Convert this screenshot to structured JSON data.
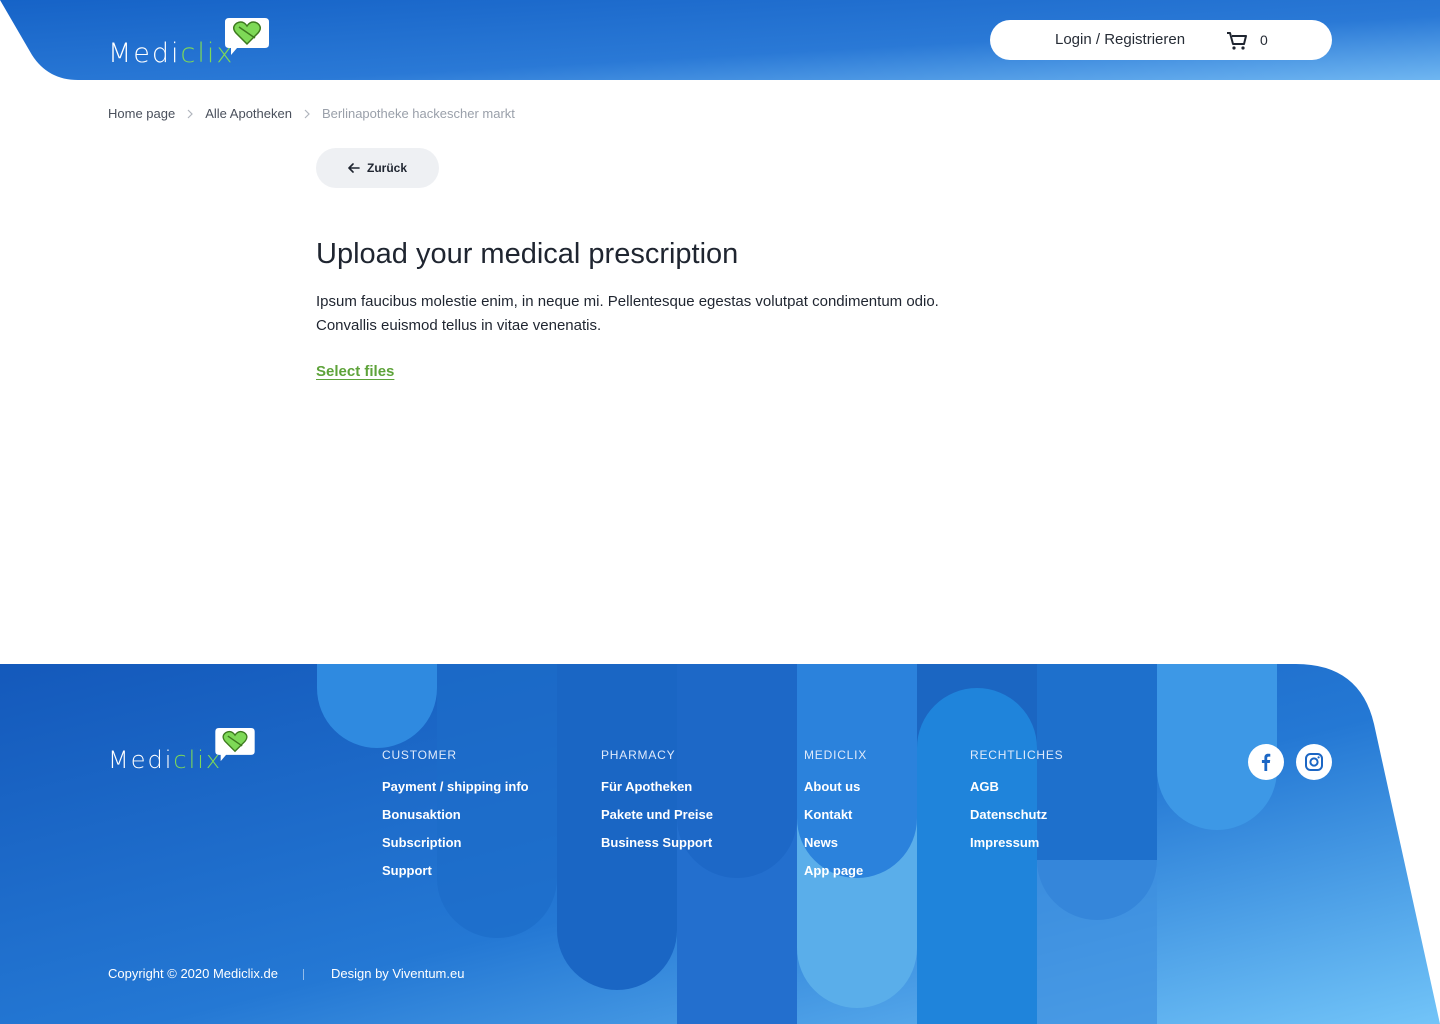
{
  "brand": {
    "name_part1": "Medi",
    "name_part2": "clix",
    "accent_green": "#7ed957",
    "primary_blue": "#1565c0"
  },
  "header": {
    "login_label": "Login / Registrieren",
    "cart_count": "0"
  },
  "breadcrumb": {
    "items": [
      "Home page",
      "Alle Apotheken",
      "Berlinapotheke hackescher markt"
    ]
  },
  "back_button": {
    "label": "Zurück"
  },
  "main": {
    "title": "Upload your medical prescription",
    "description_line1": "Ipsum faucibus molestie enim, in neque mi. Pellentesque egestas volutpat condimentum odio.",
    "description_line2": "Convallis euismod tellus in vitae venenatis.",
    "select_files_label": "Select files"
  },
  "footer": {
    "columns": [
      {
        "title": "CUSTOMER",
        "links": [
          "Payment / shipping info",
          "Bonusaktion",
          "Subscription",
          "Support"
        ]
      },
      {
        "title": "PHARMACY",
        "links": [
          "Für Apotheken",
          "Pakete und Preise",
          "Business Support"
        ]
      },
      {
        "title": "MEDICLIX",
        "links": [
          "About us",
          "Kontakt",
          "News",
          "App page"
        ]
      },
      {
        "title": "RECHTLICHES",
        "links": [
          "AGB",
          "Datenschutz",
          "Impressum"
        ]
      }
    ],
    "social": [
      "facebook-icon",
      "instagram-icon"
    ],
    "copyright": "Copyright © 2020 Mediclix.de",
    "design_by": "Design by Viventum.eu"
  }
}
